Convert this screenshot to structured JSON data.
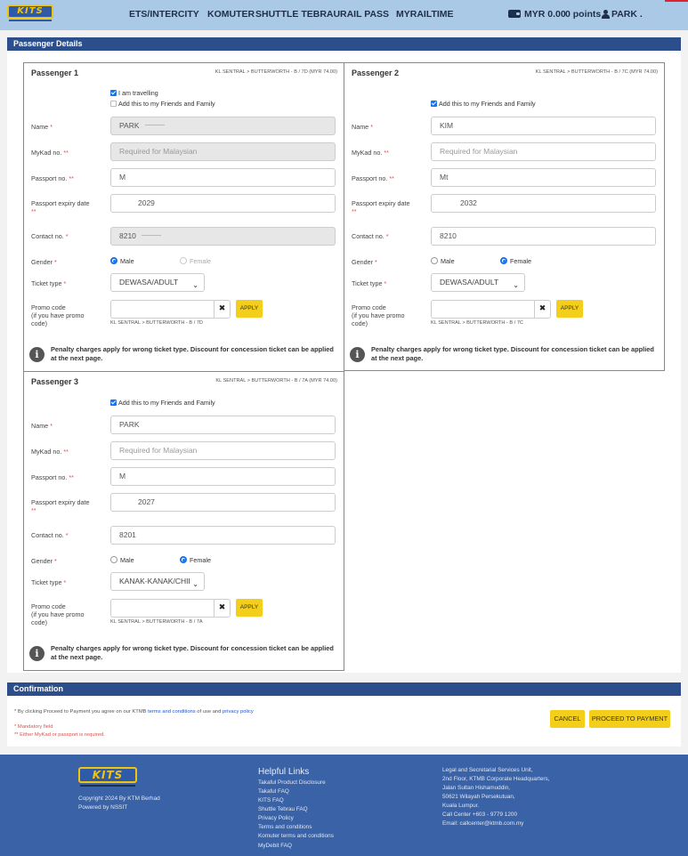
{
  "nav": {
    "logo_text": "KITS",
    "links": [
      "ETS/INTERCITY",
      "KOMUTER",
      "SHUTTLE TEBRAU",
      "RAIL PASS",
      "MYRAILTIME"
    ],
    "balance": "MYR 0.00",
    "points": "0 points",
    "user": "PARK ."
  },
  "passenger_details": {
    "header": "Passenger Details",
    "labels": {
      "name": "Name",
      "mykad": "MyKad no.",
      "passport": "Passport no.",
      "passport_expiry": "Passport expiry date",
      "contact": "Contact no.",
      "gender": "Gender",
      "ticket_type": "Ticket type",
      "promo_line1": "Promo code",
      "promo_line2": "(if you have promo",
      "promo_line3": "code)",
      "req_single": "*",
      "req_double": "**"
    },
    "gender_options": [
      "Male",
      "Female"
    ],
    "apply_label": "APPLY",
    "clear_label": "✖",
    "penalty_line1": "Penalty charges apply for wrong ticket type. Discount for concession ticket can be applied",
    "penalty_line2": "at the next page.",
    "mykad_placeholder": "Required for Malaysian",
    "passengers": [
      {
        "title": "Passenger 1",
        "route": "KL SENTRAL > BUTTERWORTH - B / 7D (MYR 74.00)",
        "i_am_travelling": "I am travelling",
        "add_friends": "Add this to my Friends and Family",
        "name": "PARK",
        "passport": "M",
        "passport_expiry": "2029",
        "contact": "8210",
        "ticket_type": "DEWASA/ADULT",
        "promo_route": "KL SENTRAL > BUTTERWORTH - B / 7D"
      },
      {
        "title": "Passenger 2",
        "route": "KL SENTRAL > BUTTERWORTH - B / 7C (MYR 74.00)",
        "add_friends": "Add this to my Friends and Family",
        "name": "KIM",
        "passport": "Mt",
        "passport_expiry": "2032",
        "contact": "8210",
        "ticket_type": "DEWASA/ADULT",
        "promo_route": "KL SENTRAL > BUTTERWORTH - B / 7C"
      },
      {
        "title": "Passenger 3",
        "route": "KL SENTRAL > BUTTERWORTH - B / 7A (MYR 74.00)",
        "add_friends": "Add this to my Friends and Family",
        "name": "PARK",
        "passport": "M",
        "passport_expiry": "2027",
        "contact": "8201",
        "ticket_type": "KANAK-KANAK/CHILD",
        "promo_route": "KL SENTRAL > BUTTERWORTH - B / 7A"
      }
    ]
  },
  "confirmation": {
    "header": "Confirmation",
    "agree_prefix": "* By clicking Proceed to Payment you agree on our KTMB",
    "terms_link": "terms and conditions",
    "agree_mid": "of use and",
    "privacy_link": "privacy policy",
    "mandatory_note": "* Mandatory field",
    "either_note": "** Either MyKad or passport is required.",
    "cancel_label": "CANCEL",
    "proceed_label": "PROCEED TO PAYMENT"
  },
  "footer": {
    "logo_text": "KITS",
    "copyright": "Copyright 2024 By KTM Berhad",
    "powered": "Powered by NSSIT",
    "helpful_title": "Helpful Links",
    "links": [
      "Takaful Product Disclosure",
      "Takaful FAQ",
      "KITS FAQ",
      "Shuttle Tebrau FAQ",
      "Privacy Policy",
      "Terms and conditions",
      "Komuter terms and conditions",
      "MyDebit FAQ"
    ],
    "address": [
      "Legal and Secretarial Services Unit,",
      "2nd Floor, KTMB Corporate Headquarters,",
      "Jalan Sultan Hishamuddin,",
      "50621 Wilayah Persekutuan,",
      "Kuala Lumpur.",
      "Call Center +603 - 9779 1200",
      "Email: callcenter@ktmb.com.my"
    ]
  },
  "colors": {
    "nav_bg": "#a9c9e6",
    "header_bg": "#2c4f8c",
    "accent_yellow": "#f3cf1b",
    "footer_bg": "#3a62a6",
    "radio_blue": "#1a73e8"
  }
}
